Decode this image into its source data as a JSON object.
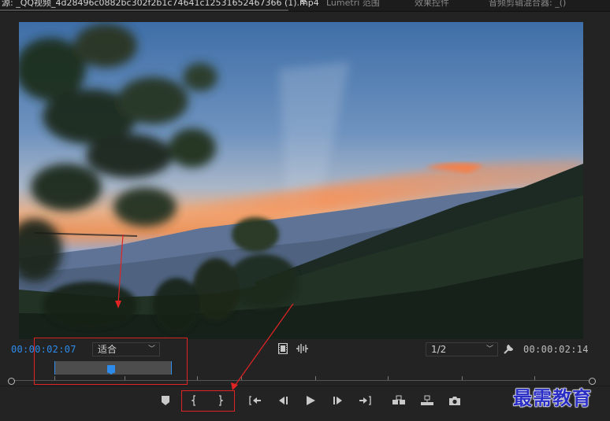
{
  "tabs": [
    {
      "label": "源: _QQ视频_4d28496c0882bc302f2b1c74641c12531652467366 (1).mp4",
      "active": true
    },
    {
      "label": "Lumetri 范围",
      "active": false
    },
    {
      "label": "效果控件",
      "active": false
    },
    {
      "label": "音频剪辑混合器: _()",
      "active": false
    }
  ],
  "tab_menu_icon": "≡",
  "monitor": {
    "current_timecode": "00:00:02:07",
    "duration_timecode": "00:00:02:14",
    "zoom_value": "适合",
    "resolution_value": "1/2",
    "zoom_bar_position": 0.49
  },
  "icons": {
    "settings": "wrench-icon",
    "export_frame": "camera-icon"
  },
  "colors": {
    "timecode_blue": "#2d8ceb",
    "annotation_red": "#e02424",
    "panel_bg": "#232323"
  },
  "watermark": "最需教育"
}
